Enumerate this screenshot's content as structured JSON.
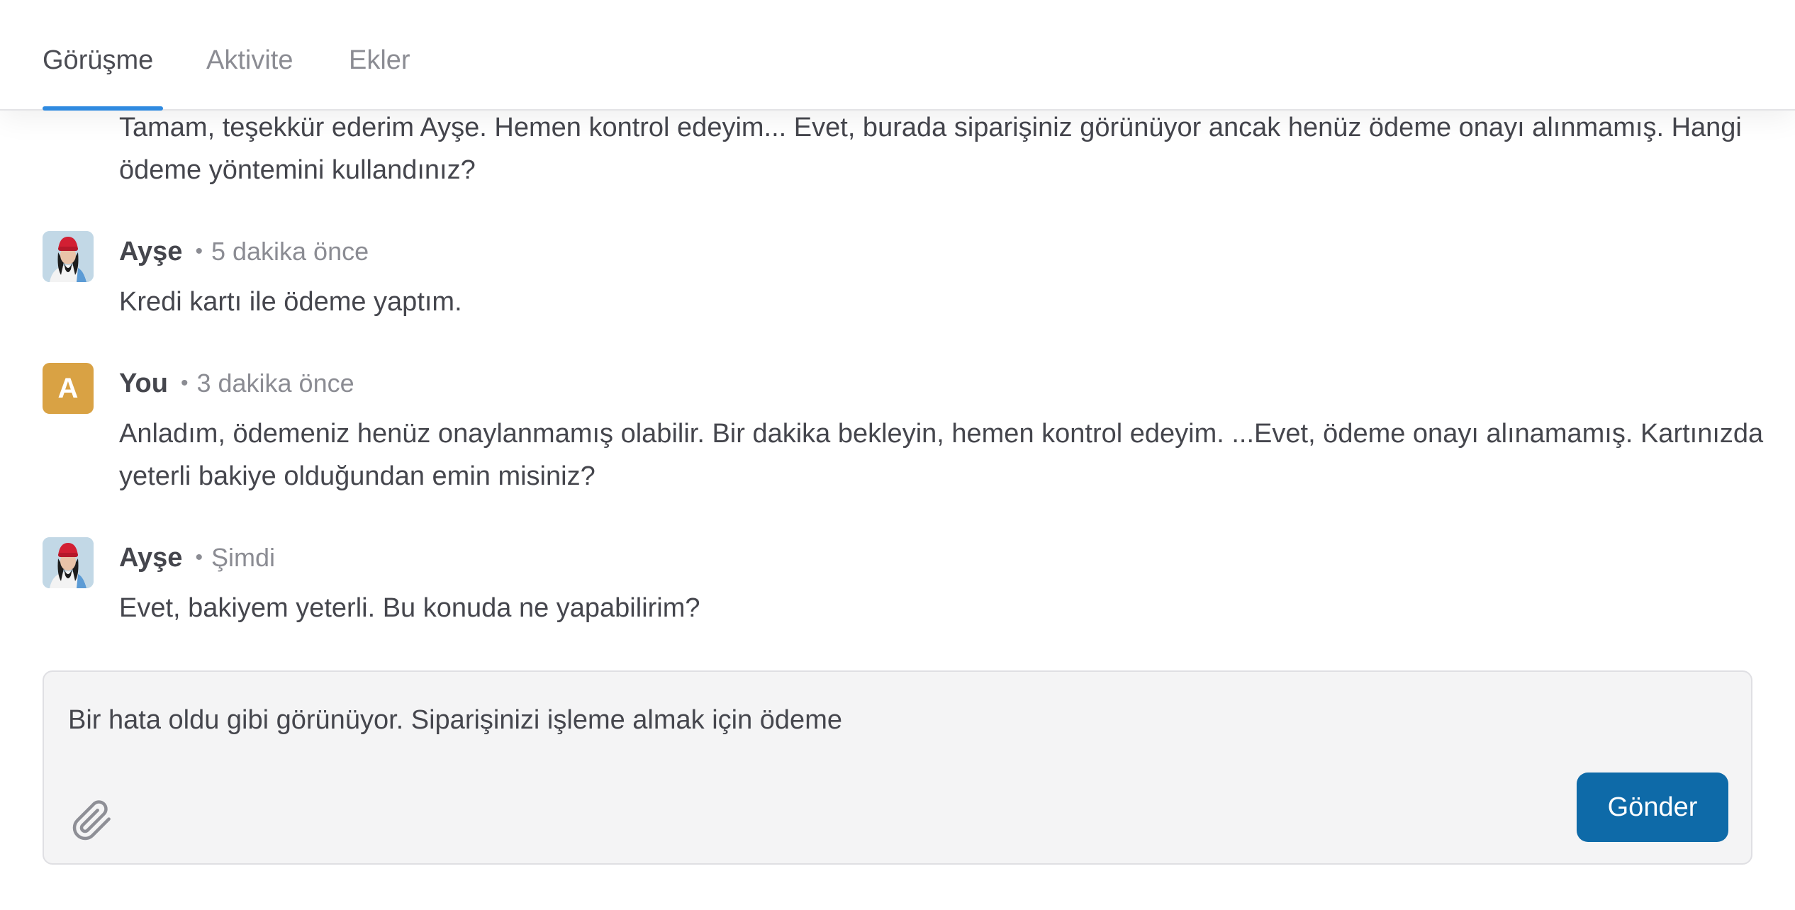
{
  "tabs": [
    {
      "label": "Görüşme",
      "active": true
    },
    {
      "label": "Aktivite",
      "active": false
    },
    {
      "label": "Ekler",
      "active": false
    }
  ],
  "colors": {
    "accent": "#2f8ae0",
    "send_button": "#0e6aa8",
    "you_avatar": "#d9a244"
  },
  "messages": [
    {
      "text": "Tamam, teşekkür ederim Ayşe. Hemen kontrol edeyim... Evet, burada siparişiniz görünüyor ancak henüz ödeme onayı alınmamış. Hangi ödeme yöntemini kullandınız?"
    },
    {
      "author": "Ayşe",
      "time": "5 dakika önce",
      "avatar": "user-photo-avatar",
      "text": "Kredi kartı ile ödeme yaptım."
    },
    {
      "author": "You",
      "time": "3 dakika önce",
      "avatar_letter": "A",
      "text": "Anladım, ödemeniz henüz onaylanmamış olabilir. Bir dakika bekleyin, hemen kontrol edeyim. ...Evet, ödeme onayı alınamamış. Kartınızda yeterli bakiye olduğundan emin misiniz?"
    },
    {
      "author": "Ayşe",
      "time": "Şimdi",
      "avatar": "user-photo-avatar",
      "text": "Evet, bakiyem yeterli. Bu konuda ne yapabilirim?"
    }
  ],
  "composer": {
    "value": "Bir hata oldu gibi görünüyor. Siparişinizi işleme almak için ödeme",
    "attach_icon": "paperclip-icon",
    "send_label": "Gönder"
  }
}
